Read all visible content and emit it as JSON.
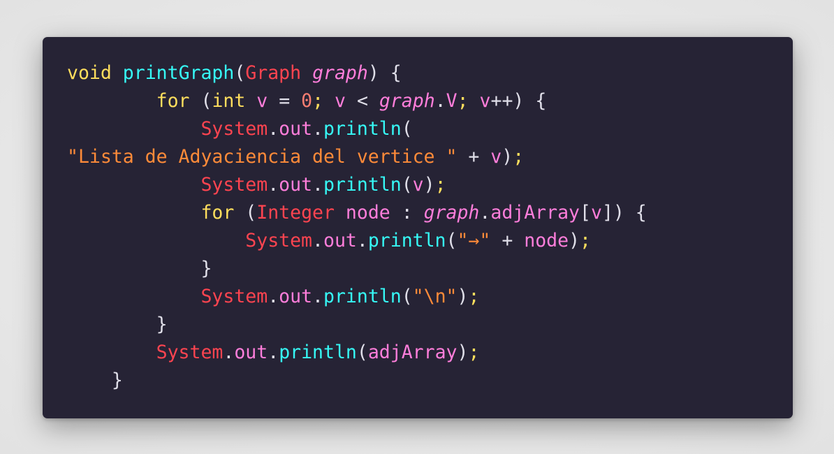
{
  "colors": {
    "background": "#262335",
    "page": "#e6e6e6",
    "keyword": "#fede5d",
    "function": "#36f9f6",
    "type": "#fe4450",
    "variable": "#ff7edb",
    "number": "#f97e72",
    "string": "#ff8b39",
    "punctuation": "#e0dfe9"
  },
  "code": {
    "lines": [
      [
        {
          "t": "void",
          "c": "kw"
        },
        {
          "t": " ",
          "c": "plain"
        },
        {
          "t": "printGraph",
          "c": "fn"
        },
        {
          "t": "(",
          "c": "punc"
        },
        {
          "t": "Graph",
          "c": "type"
        },
        {
          "t": " ",
          "c": "plain"
        },
        {
          "t": "graph",
          "c": "param"
        },
        {
          "t": ") {",
          "c": "punc"
        }
      ],
      [
        {
          "t": "        ",
          "c": "plain"
        },
        {
          "t": "for",
          "c": "kw"
        },
        {
          "t": " (",
          "c": "punc"
        },
        {
          "t": "int",
          "c": "kw"
        },
        {
          "t": " ",
          "c": "plain"
        },
        {
          "t": "v",
          "c": "var"
        },
        {
          "t": " = ",
          "c": "punc"
        },
        {
          "t": "0",
          "c": "num"
        },
        {
          "t": ";",
          "c": "semi"
        },
        {
          "t": " ",
          "c": "plain"
        },
        {
          "t": "v",
          "c": "var"
        },
        {
          "t": " < ",
          "c": "punc"
        },
        {
          "t": "graph",
          "c": "param"
        },
        {
          "t": ".",
          "c": "punc"
        },
        {
          "t": "V",
          "c": "field"
        },
        {
          "t": ";",
          "c": "semi"
        },
        {
          "t": " ",
          "c": "plain"
        },
        {
          "t": "v",
          "c": "var"
        },
        {
          "t": "++",
          "c": "punc"
        },
        {
          "t": ") {",
          "c": "punc"
        }
      ],
      [
        {
          "t": "            ",
          "c": "plain"
        },
        {
          "t": "System",
          "c": "type"
        },
        {
          "t": ".",
          "c": "punc"
        },
        {
          "t": "out",
          "c": "field"
        },
        {
          "t": ".",
          "c": "punc"
        },
        {
          "t": "println",
          "c": "fn"
        },
        {
          "t": "(",
          "c": "punc"
        }
      ],
      [
        {
          "t": "\"Lista de Adyaciencia del vertice \"",
          "c": "str"
        },
        {
          "t": " + ",
          "c": "punc"
        },
        {
          "t": "v",
          "c": "var"
        },
        {
          "t": ")",
          "c": "punc"
        },
        {
          "t": ";",
          "c": "semi"
        }
      ],
      [
        {
          "t": "            ",
          "c": "plain"
        },
        {
          "t": "System",
          "c": "type"
        },
        {
          "t": ".",
          "c": "punc"
        },
        {
          "t": "out",
          "c": "field"
        },
        {
          "t": ".",
          "c": "punc"
        },
        {
          "t": "println",
          "c": "fn"
        },
        {
          "t": "(",
          "c": "punc"
        },
        {
          "t": "v",
          "c": "var"
        },
        {
          "t": ")",
          "c": "punc"
        },
        {
          "t": ";",
          "c": "semi"
        }
      ],
      [
        {
          "t": "            ",
          "c": "plain"
        },
        {
          "t": "for",
          "c": "kw"
        },
        {
          "t": " (",
          "c": "punc"
        },
        {
          "t": "Integer",
          "c": "type"
        },
        {
          "t": " ",
          "c": "plain"
        },
        {
          "t": "node",
          "c": "var"
        },
        {
          "t": " : ",
          "c": "punc"
        },
        {
          "t": "graph",
          "c": "param"
        },
        {
          "t": ".",
          "c": "punc"
        },
        {
          "t": "adjArray",
          "c": "field"
        },
        {
          "t": "[",
          "c": "punc"
        },
        {
          "t": "v",
          "c": "var"
        },
        {
          "t": "]) {",
          "c": "punc"
        }
      ],
      [
        {
          "t": "                ",
          "c": "plain"
        },
        {
          "t": "System",
          "c": "type"
        },
        {
          "t": ".",
          "c": "punc"
        },
        {
          "t": "out",
          "c": "field"
        },
        {
          "t": ".",
          "c": "punc"
        },
        {
          "t": "println",
          "c": "fn"
        },
        {
          "t": "(",
          "c": "punc"
        },
        {
          "t": "\"→\"",
          "c": "str"
        },
        {
          "t": " + ",
          "c": "punc"
        },
        {
          "t": "node",
          "c": "var"
        },
        {
          "t": ")",
          "c": "punc"
        },
        {
          "t": ";",
          "c": "semi"
        }
      ],
      [
        {
          "t": "            ",
          "c": "plain"
        },
        {
          "t": "}",
          "c": "punc"
        }
      ],
      [
        {
          "t": "            ",
          "c": "plain"
        },
        {
          "t": "System",
          "c": "type"
        },
        {
          "t": ".",
          "c": "punc"
        },
        {
          "t": "out",
          "c": "field"
        },
        {
          "t": ".",
          "c": "punc"
        },
        {
          "t": "println",
          "c": "fn"
        },
        {
          "t": "(",
          "c": "punc"
        },
        {
          "t": "\"\\n\"",
          "c": "str"
        },
        {
          "t": ")",
          "c": "punc"
        },
        {
          "t": ";",
          "c": "semi"
        }
      ],
      [
        {
          "t": "        ",
          "c": "plain"
        },
        {
          "t": "}",
          "c": "punc"
        }
      ],
      [
        {
          "t": "        ",
          "c": "plain"
        },
        {
          "t": "System",
          "c": "type"
        },
        {
          "t": ".",
          "c": "punc"
        },
        {
          "t": "out",
          "c": "field"
        },
        {
          "t": ".",
          "c": "punc"
        },
        {
          "t": "println",
          "c": "fn"
        },
        {
          "t": "(",
          "c": "punc"
        },
        {
          "t": "adjArray",
          "c": "field"
        },
        {
          "t": ")",
          "c": "punc"
        },
        {
          "t": ";",
          "c": "semi"
        }
      ],
      [
        {
          "t": "    ",
          "c": "plain"
        },
        {
          "t": "}",
          "c": "punc"
        }
      ]
    ]
  }
}
